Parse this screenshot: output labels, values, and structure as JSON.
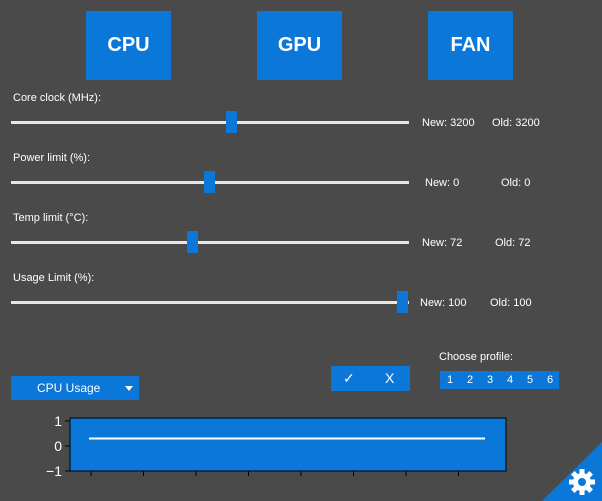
{
  "tabs": [
    "CPU",
    "GPU",
    "FAN"
  ],
  "sliders": [
    {
      "label": "Core clock (MHz):",
      "level": 0.55,
      "new": "New: 3200",
      "old": "Old: 3200"
    },
    {
      "label": "Power limit (%):",
      "level": 0.5,
      "new": "New: 0",
      "old": "Old: 0"
    },
    {
      "label": "Temp limit (°C):",
      "level": 0.45,
      "new": "New: 72",
      "old": "Old: 72"
    },
    {
      "label": "Usage Limit (%):",
      "level": 1.0,
      "new": "New: 100",
      "old": "Old: 100"
    }
  ],
  "dropdown": {
    "selected": "CPU Usage"
  },
  "actions": {
    "apply": "✓",
    "cancel": "X"
  },
  "profile": {
    "label": "Choose profile:",
    "options": [
      "1",
      "2",
      "3",
      "4",
      "5",
      "6"
    ]
  },
  "chart_data": {
    "type": "line",
    "yticks": [
      "1",
      "0",
      "−1"
    ],
    "ylim": [
      -1,
      1
    ],
    "series": [
      {
        "values": [
          0.3,
          0.3
        ]
      }
    ]
  },
  "colors": {
    "accent": "#0b78d9",
    "background": "#4a4a4a",
    "track": "#e6e6e6"
  },
  "icons": {
    "settings": "gear-icon"
  }
}
